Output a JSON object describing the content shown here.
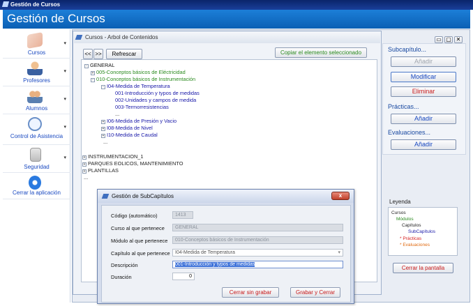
{
  "window": {
    "title": "Gestión de Cursos"
  },
  "header": {
    "title": "Gestión de Cursos"
  },
  "nav": [
    {
      "label": "Cursos",
      "icon": "book-icon"
    },
    {
      "label": "Profesores",
      "icon": "teacher-icon"
    },
    {
      "label": "Alumnos",
      "icon": "students-icon"
    },
    {
      "label": "Control de Asistencia",
      "icon": "clock-icon"
    },
    {
      "label": "Seguridad",
      "icon": "lock-icon"
    },
    {
      "label": "Cerrar la aplicación",
      "icon": "power-icon"
    }
  ],
  "panel": {
    "title": "Cursos - Arbol de Contenidos",
    "prev": "<<",
    "next": ">>",
    "refresh": "Refrescar",
    "copy": "Copiar el elemento seleccionado"
  },
  "tree": [
    {
      "text": "GENERAL",
      "cls": "black",
      "tog": "-"
    },
    {
      "text": "005-Conceptos básicos de Eléctricidad",
      "cls": "green",
      "tog": "+"
    },
    {
      "text": "010-Conceptos básicos de Instrumentación",
      "cls": "green",
      "tog": "-"
    },
    {
      "text": "I04-Medida de Temperatura",
      "cls": "blue",
      "tog": "-"
    },
    {
      "text": "001-Introducción y typos de medidas",
      "cls": "blue",
      "tog": ""
    },
    {
      "text": "002-Unidades y campos de medida",
      "cls": "blue",
      "tog": ""
    },
    {
      "text": "003-Termorresistencias",
      "cls": "blue",
      "tog": ""
    },
    {
      "text": "...",
      "cls": "black",
      "tog": ""
    },
    {
      "text": "I06-Medida de Presión y Vacio",
      "cls": "blue",
      "tog": "+"
    },
    {
      "text": "I08-Medida de Nivel",
      "cls": "blue",
      "tog": "+"
    },
    {
      "text": "I10-Medida de Caudal",
      "cls": "blue",
      "tog": "+"
    },
    {
      "text": "...",
      "cls": "black",
      "tog": ""
    },
    {
      "text": "INSTRUMENTACION_1",
      "cls": "dark",
      "tog": "+"
    },
    {
      "text": "PARQUES EOLICOS, MANTENIMIENTO",
      "cls": "dark",
      "tog": "+"
    },
    {
      "text": "PLANTILLAS",
      "cls": "dark",
      "tog": "+"
    },
    {
      "text": "...",
      "cls": "black",
      "tog": ""
    }
  ],
  "side": {
    "subcap": "Subcapítulo...",
    "add": "Añadir",
    "modify": "Modificar",
    "delete": "Eliminar",
    "practicas": "Prácticas...",
    "add2": "Añadir",
    "evaluaciones": "Evaluaciones...",
    "add3": "Añadir",
    "legend_title": "Leyenda",
    "legend": [
      {
        "text": "Cursos",
        "color": "#222222"
      },
      {
        "text": "Módulos",
        "color": "#2a8a1e"
      },
      {
        "text": "Capítulos",
        "color": "#222222"
      },
      {
        "text": "SubCapítulos",
        "color": "#1818a8"
      },
      {
        "text": "* Prácticas",
        "color": "#d41c1c"
      },
      {
        "text": "* Evaluaciones",
        "color": "#e06a10"
      }
    ],
    "close": "Cerrar la pantalla"
  },
  "dialog": {
    "title": "Gestión de SubCapítulos",
    "close": "x",
    "fields": [
      {
        "label": "Código (automático)",
        "value": "1413"
      },
      {
        "label": "Curso al que pertenece",
        "value": "GENERAL"
      },
      {
        "label": "Módulo al que pertenece",
        "value": "010-Conceptos básicos de Instrumentación"
      },
      {
        "label": "Capítulo al que pertenece",
        "value": "I04-Medida de Temperatura"
      },
      {
        "label": "Descripción",
        "value": "001-Introducción y typos de medidas"
      },
      {
        "label": "Duración",
        "value": "0"
      }
    ],
    "cancel": "Cerrar sin grabar",
    "save": "Grabar y Cerrar"
  }
}
